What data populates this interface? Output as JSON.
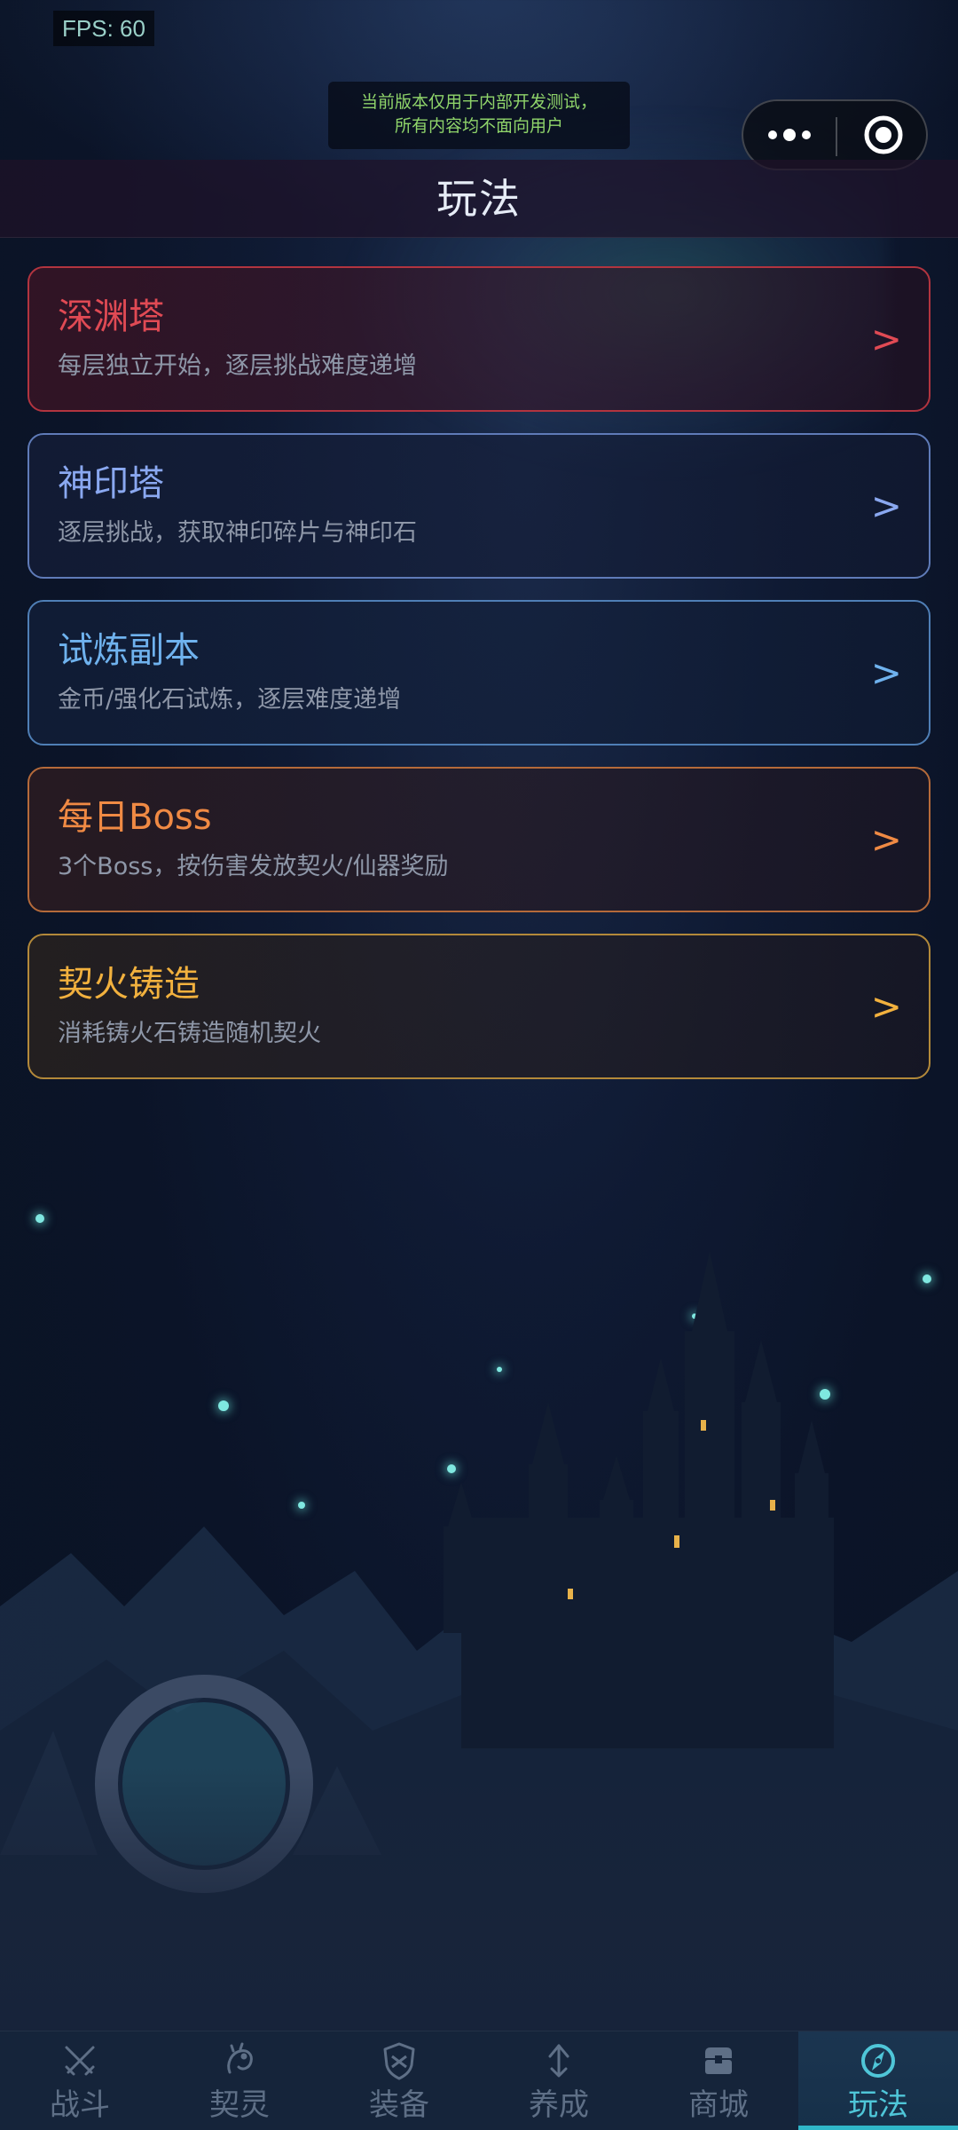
{
  "status": {
    "fps_text": "FPS: 60"
  },
  "notice": {
    "line1": "当前版本仅用于内部开发测试，",
    "line2": "所有内容均不面向用户"
  },
  "capsule": {
    "more_icon": "more-dots-icon",
    "close_icon": "target-close-icon"
  },
  "header": {
    "title": "玩法"
  },
  "cards": [
    {
      "name": "深渊塔",
      "desc": "每层独立开始，逐层挑战难度递增",
      "arrow": ">",
      "color": "#e04a54"
    },
    {
      "name": "神印塔",
      "desc": "逐层挑战，获取神印碎片与神印石",
      "arrow": ">",
      "color": "#8aa8f0"
    },
    {
      "name": "试炼副本",
      "desc": "金币/强化石试炼，逐层难度递增",
      "arrow": ">",
      "color": "#6fb2ee"
    },
    {
      "name": "每日Boss",
      "desc": "3个Boss，按伤害发放契火/仙器奖励",
      "arrow": ">",
      "color": "#f08a44"
    },
    {
      "name": "契火铸造",
      "desc": "消耗铸火石铸造随机契火",
      "arrow": ">",
      "color": "#f2b13e"
    }
  ],
  "tabbar": {
    "tabs": [
      {
        "label": "战斗",
        "icon": "crossed-swords-icon"
      },
      {
        "label": "契灵",
        "icon": "spirit-beast-icon"
      },
      {
        "label": "装备",
        "icon": "shield-icon"
      },
      {
        "label": "养成",
        "icon": "upgrade-arrow-icon"
      },
      {
        "label": "商城",
        "icon": "shop-chest-icon"
      },
      {
        "label": "玩法",
        "icon": "compass-icon"
      }
    ],
    "active_index": 5,
    "active_color": "#4fc6d8"
  }
}
